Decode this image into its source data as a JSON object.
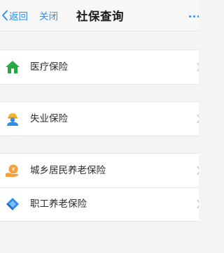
{
  "navbar": {
    "back_label": "返回",
    "close_label": "关闭",
    "title": "社保查询",
    "more_icon": "more-dots-icon",
    "accent_color": "#2a8ff0"
  },
  "groups": [
    {
      "items": [
        {
          "label": "医疗保险",
          "icon": "house-icon",
          "icon_color": "#25a845"
        }
      ]
    },
    {
      "items": [
        {
          "label": "失业保险",
          "icon": "worker-icon",
          "icon_color": "#2a8ff0"
        }
      ]
    },
    {
      "items": [
        {
          "label": "城乡居民养老保险",
          "icon": "yuan-hand-icon",
          "icon_color": "#f2a13a"
        },
        {
          "label": "职工养老保险",
          "icon": "diamond-icon",
          "icon_color": "#2a8ff0"
        }
      ]
    }
  ]
}
